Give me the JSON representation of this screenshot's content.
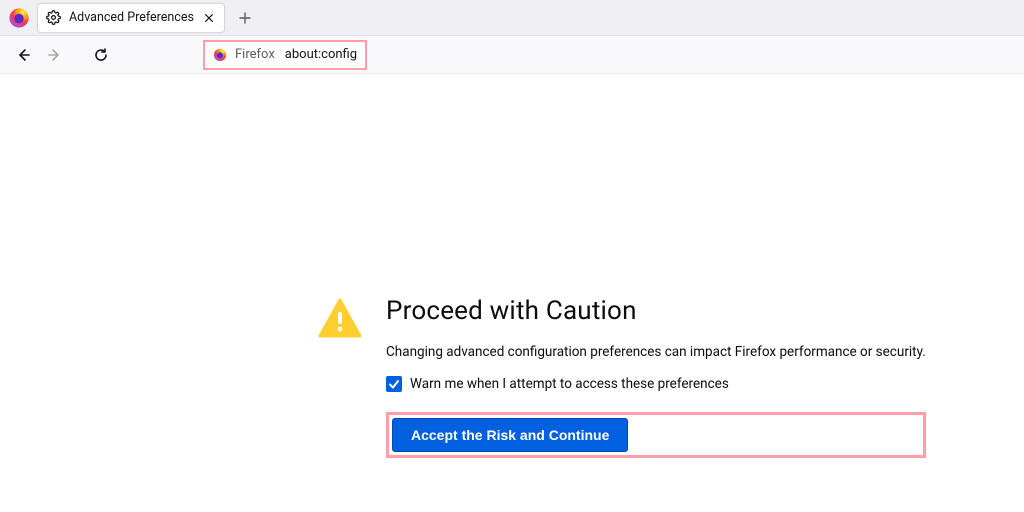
{
  "tab": {
    "title": "Advanced Preferences"
  },
  "urlbar": {
    "brand": "Firefox",
    "path": "about:config"
  },
  "warning": {
    "title": "Proceed with Caution",
    "description": "Changing advanced configuration preferences can impact Firefox performance or security.",
    "checkbox_label": "Warn me when I attempt to access these preferences",
    "accept_label": "Accept the Risk and Continue"
  }
}
